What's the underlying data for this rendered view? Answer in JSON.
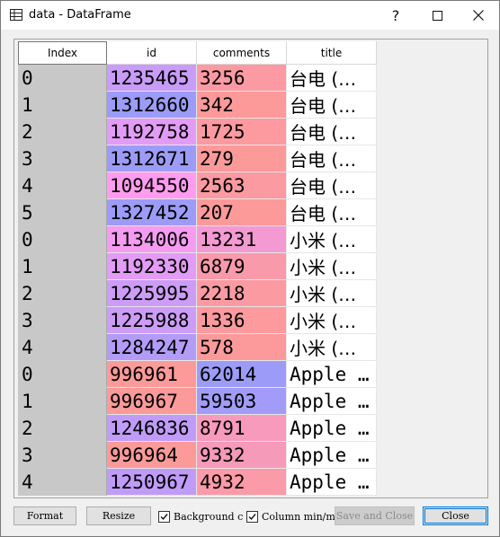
{
  "window": {
    "title": "data - DataFrame",
    "icon": "table-grid-icon",
    "controls": [
      "help-icon",
      "minimize-icon",
      "maximize-icon",
      "close-icon"
    ]
  },
  "table": {
    "headers": [
      "Index",
      "id",
      "comments",
      "title"
    ],
    "rows": [
      {
        "index": "0",
        "id": "1235465",
        "comments": "3256",
        "title": "台电 (…",
        "id_color": "#c89cf8",
        "comments_color": "#fc9aa3"
      },
      {
        "index": "1",
        "id": "1312660",
        "comments": "342",
        "title": "台电 (…",
        "id_color": "#9c9cf8",
        "comments_color": "#fc9a9a"
      },
      {
        "index": "2",
        "id": "1192758",
        "comments": "1725",
        "title": "台电 (…",
        "id_color": "#e39cf5",
        "comments_color": "#fc9aa0"
      },
      {
        "index": "3",
        "id": "1312671",
        "comments": "279",
        "title": "台电 (…",
        "id_color": "#9c9cf8",
        "comments_color": "#fc9a9a"
      },
      {
        "index": "4",
        "id": "1094550",
        "comments": "2563",
        "title": "台电 (…",
        "id_color": "#ff9cf0",
        "comments_color": "#fc9aa2"
      },
      {
        "index": "5",
        "id": "1327452",
        "comments": "207",
        "title": "台电 (…",
        "id_color": "#9c9cf8",
        "comments_color": "#fc9a9a"
      },
      {
        "index": "0",
        "id": "1134006",
        "comments": "13231",
        "title": "小米 (…",
        "id_color": "#f59cf2",
        "comments_color": "#f49ad3"
      },
      {
        "index": "1",
        "id": "1192330",
        "comments": "6879",
        "title": "小米 (…",
        "id_color": "#e39cf5",
        "comments_color": "#f99aab"
      },
      {
        "index": "2",
        "id": "1225995",
        "comments": "2218",
        "title": "小米 (…",
        "id_color": "#cc9cf7",
        "comments_color": "#fc9aa1"
      },
      {
        "index": "3",
        "id": "1225988",
        "comments": "1336",
        "title": "小米 (…",
        "id_color": "#cc9cf7",
        "comments_color": "#fc9a9e"
      },
      {
        "index": "4",
        "id": "1284247",
        "comments": "578",
        "title": "小米 (…",
        "id_color": "#b29cf8",
        "comments_color": "#fc9a9b"
      },
      {
        "index": "0",
        "id": "996961",
        "comments": "62014",
        "title": "Apple …",
        "id_color": "#fc9a9a",
        "comments_color": "#9c9cf8"
      },
      {
        "index": "1",
        "id": "996967",
        "comments": "59503",
        "title": "Apple …",
        "id_color": "#fc9a9a",
        "comments_color": "#a29cf8"
      },
      {
        "index": "2",
        "id": "1246836",
        "comments": "8791",
        "title": "Apple …",
        "id_color": "#c09cf8",
        "comments_color": "#f89abc"
      },
      {
        "index": "3",
        "id": "996964",
        "comments": "9332",
        "title": "Apple …",
        "id_color": "#fc9a9a",
        "comments_color": "#f69ab9"
      },
      {
        "index": "4",
        "id": "1250967",
        "comments": "4932",
        "title": "Apple …",
        "id_color": "#c09cf8",
        "comments_color": "#fb9aa8"
      }
    ]
  },
  "toolbar": {
    "format_label": "Format",
    "resize_label": "Resize",
    "background_label": "Background c",
    "background_checked": true,
    "column_minmax_label": "Column min/m",
    "column_minmax_checked": true,
    "save_close_label": "Save and Close",
    "close_label": "Close"
  },
  "colors": {
    "index_bg": "#c8c8c8",
    "accent": "#0078d7"
  }
}
